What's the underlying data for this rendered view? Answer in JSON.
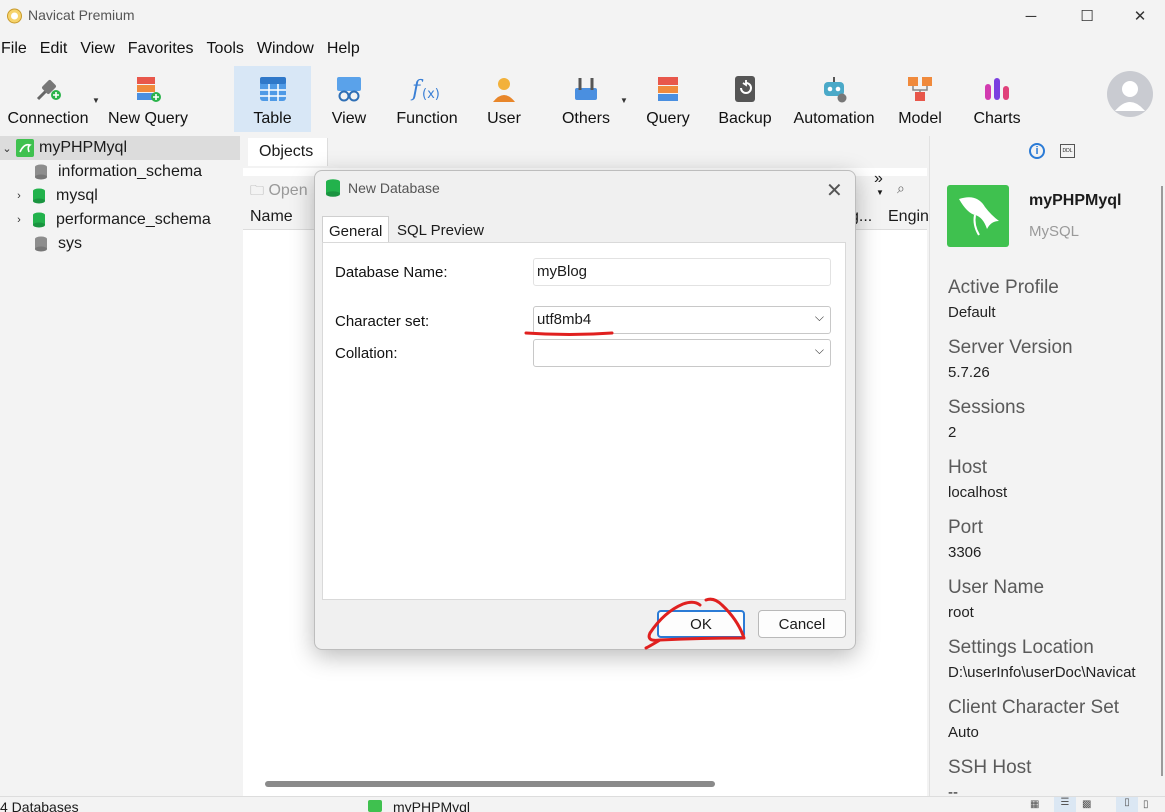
{
  "window": {
    "title": "Navicat Premium",
    "minimize": "─",
    "maximize": "☐",
    "close": "✕"
  },
  "menu": [
    "File",
    "Edit",
    "View",
    "Favorites",
    "Tools",
    "Window",
    "Help"
  ],
  "toolbar": {
    "connection": "Connection",
    "new_query": "New Query",
    "table": "Table",
    "view": "View",
    "function": "Function",
    "user": "User",
    "others": "Others",
    "query": "Query",
    "backup": "Backup",
    "automation": "Automation",
    "model": "Model",
    "charts": "Charts"
  },
  "nav": {
    "connection": "myPHPMyql",
    "databases": [
      "information_schema",
      "mysql",
      "performance_schema",
      "sys"
    ]
  },
  "center": {
    "tab": "Objects",
    "open": "Open",
    "col_name": "Name",
    "col_g": "g...",
    "col_engine": "Engin",
    "more": "»"
  },
  "dialog": {
    "title": "New Database",
    "tabs": [
      "General",
      "SQL Preview"
    ],
    "db_name_label": "Database Name:",
    "db_name_value": "myBlog",
    "charset_label": "Character set:",
    "charset_value": "utf8mb4",
    "collation_label": "Collation:",
    "collation_value": "",
    "ok": "OK",
    "cancel": "Cancel"
  },
  "info": {
    "name": "myPHPMyql",
    "type": "MySQL",
    "rows": [
      {
        "label": "Active Profile",
        "value": "Default"
      },
      {
        "label": "Server Version",
        "value": "5.7.26"
      },
      {
        "label": "Sessions",
        "value": "2"
      },
      {
        "label": "Host",
        "value": "localhost"
      },
      {
        "label": "Port",
        "value": "3306"
      },
      {
        "label": "User Name",
        "value": "root"
      },
      {
        "label": "Settings Location",
        "value": "D:\\userInfo\\userDoc\\Navicat"
      },
      {
        "label": "Client Character Set",
        "value": "Auto"
      },
      {
        "label": "SSH Host",
        "value": "--"
      }
    ]
  },
  "status": {
    "count": "4 Databases",
    "connection": "myPHPMyql"
  },
  "colors": {
    "accent": "#2b7bd6",
    "annotation": "#e0201f",
    "db_green": "#1aa14a",
    "mysql_green": "#3fc14f"
  }
}
